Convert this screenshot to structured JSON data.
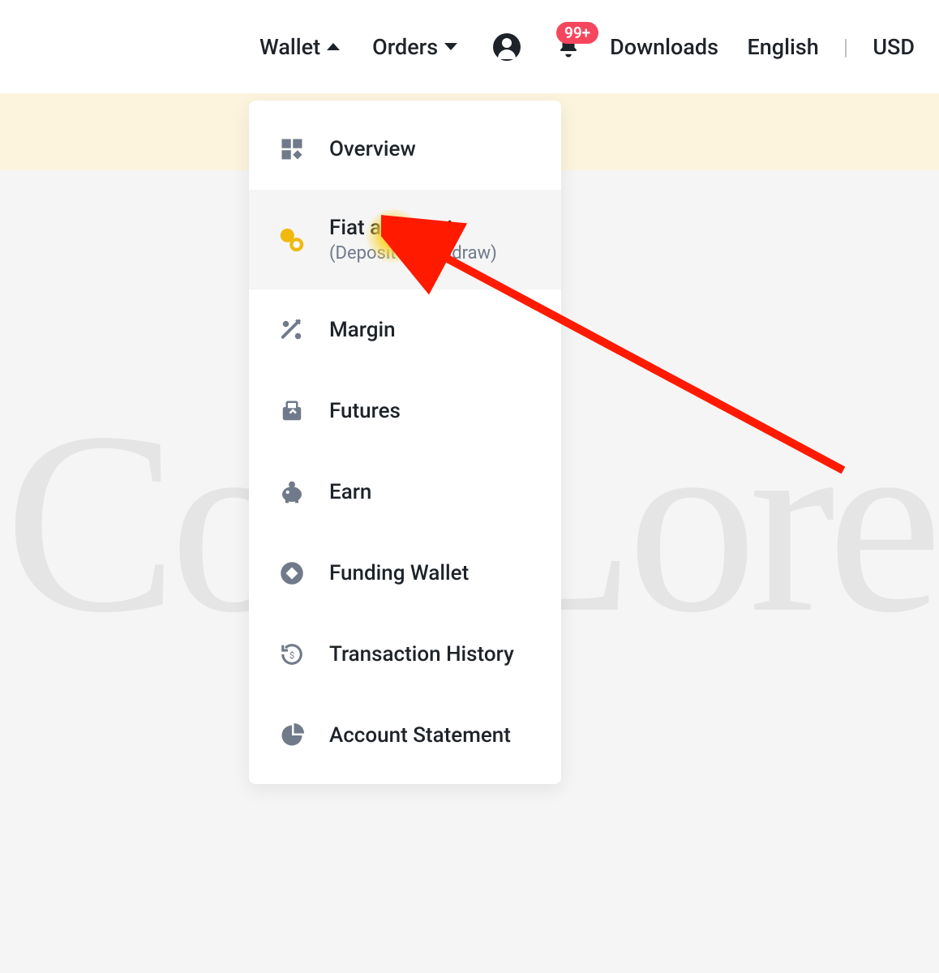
{
  "nav": {
    "wallet": "Wallet",
    "orders": "Orders",
    "downloads": "Downloads",
    "language": "English",
    "currency": "USD"
  },
  "badge": {
    "count": "99+"
  },
  "dropdown": {
    "overview": "Overview",
    "fiat_spot": "Fiat and Spot",
    "fiat_spot_sub": "(Deposit & Withdraw)",
    "margin": "Margin",
    "futures": "Futures",
    "earn": "Earn",
    "funding_wallet": "Funding Wallet",
    "transaction_history": "Transaction History",
    "account_statement": "Account Statement"
  },
  "watermark": "CoinLore",
  "annotation": {
    "arrow_color": "#ff0000"
  }
}
